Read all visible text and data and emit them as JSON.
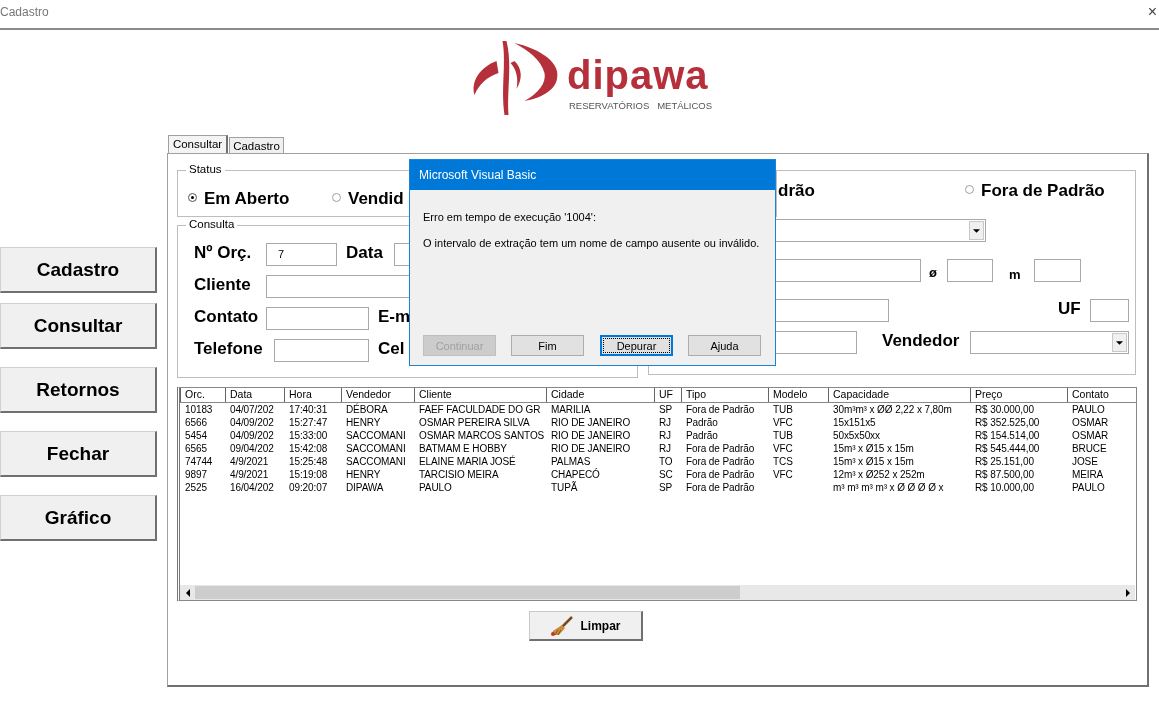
{
  "window": {
    "title": "Cadastro",
    "close": "×"
  },
  "logo": {
    "name": "dipawa",
    "tagline": "RESERVATÓRIOS   METÁLICOS"
  },
  "tabs": [
    {
      "label": "Consultar",
      "selected": true
    },
    {
      "label": "Cadastro",
      "selected": false
    }
  ],
  "side_buttons": [
    "Cadastro",
    "Consultar",
    "Retornos",
    "Fechar",
    "Gráfico"
  ],
  "status": {
    "title": "Status",
    "options": [
      {
        "label": "Em Aberto",
        "selected": true
      },
      {
        "label": "Vendid",
        "selected": false
      },
      {
        "label": "Fora de Padrão",
        "selected": false
      }
    ],
    "partial_label": "drão"
  },
  "consulta": {
    "title": "Consulta",
    "labels": [
      "Nº Orç.",
      "Data",
      "Cliente",
      "Contato",
      "E-m",
      "Telefone",
      "Cel"
    ],
    "order_number": "7"
  },
  "filters": {
    "labels": [
      "ø",
      "m",
      "UF",
      "Vendedor"
    ]
  },
  "table": {
    "columns": [
      "Orc.",
      "Data",
      "Hora",
      "Vendedor",
      "Cliente",
      "Cidade",
      "UF",
      "Tipo",
      "Modelo",
      "Capacidade",
      "Preço",
      "Contato"
    ],
    "rows": [
      [
        "10183",
        "04/07/202",
        "17:40:31",
        "DÉBORA",
        "FAEF FACULDADE DO GR",
        "MARILIA",
        "SP",
        "Fora de Padrão",
        "TUB",
        "30m³m³ x ØØ 2,22 x 7,80m",
        "R$ 30.000,00",
        "PAULO"
      ],
      [
        "6566",
        "04/09/202",
        "15:27:47",
        "HENRY",
        "OSMAR PEREIRA SILVA",
        "RIO DE JANEIRO",
        "RJ",
        "Padrão",
        "VFC",
        "15x151x5",
        "R$ 352.525,00",
        "OSMAR"
      ],
      [
        "5454",
        "04/09/202",
        "15:33:00",
        "SACCOMANI",
        "OSMAR MARCOS SANTOS",
        "RIO DE JANEIRO",
        "RJ",
        "Padrão",
        "TUB",
        "50x5x50xx",
        "R$ 154.514,00",
        "OSMAR"
      ],
      [
        "6565",
        "09/04/202",
        "15:42:08",
        "SACCOMANI",
        "BATMAM E HOBBY",
        "RIO DE JANEIRO",
        "RJ",
        "Fora de Padrão",
        "VFC",
        "15m³ x Ø15 x 15m",
        "R$ 545.444,00",
        "BRUCE"
      ],
      [
        "74744",
        "4/9/2021",
        "15:25:48",
        "SACCOMANI",
        "ELAINE MARIA JOSÉ",
        "PALMAS",
        "TO",
        "Fora de Padrão",
        "TCS",
        "15m³ x Ø15 x 15m",
        "R$ 25.151,00",
        "JOSE"
      ],
      [
        "9897",
        "4/9/2021",
        "15:19:08",
        "HENRY",
        "TARCISIO MEIRA",
        "CHAPECÓ",
        "SC",
        "Fora de Padrão",
        "VFC",
        "12m³ x Ø252 x 252m",
        "R$ 87.500,00",
        "MEIRA"
      ],
      [
        "2525",
        "16/04/202",
        "09:20:07",
        "DIPAWA",
        "PAULO",
        "TUPÃ",
        "SP",
        "Fora de Padrão",
        "",
        "m³ m³ m³ m³ x Ø Ø Ø Ø    x",
        "R$ 10.000,00",
        "PAULO"
      ]
    ]
  },
  "clear_button": "Limpar",
  "dialog": {
    "title": "Microsoft Visual Basic",
    "lines": [
      "Erro em tempo de execução '1004':",
      "O intervalo de extração tem um nome de campo ausente ou inválido."
    ],
    "buttons": [
      {
        "label": "Continuar",
        "disabled": true,
        "focused": false
      },
      {
        "label": "Fim",
        "disabled": false,
        "focused": false
      },
      {
        "label": "Depurar",
        "disabled": false,
        "focused": true
      },
      {
        "label": "Ajuda",
        "disabled": false,
        "focused": false
      }
    ]
  }
}
